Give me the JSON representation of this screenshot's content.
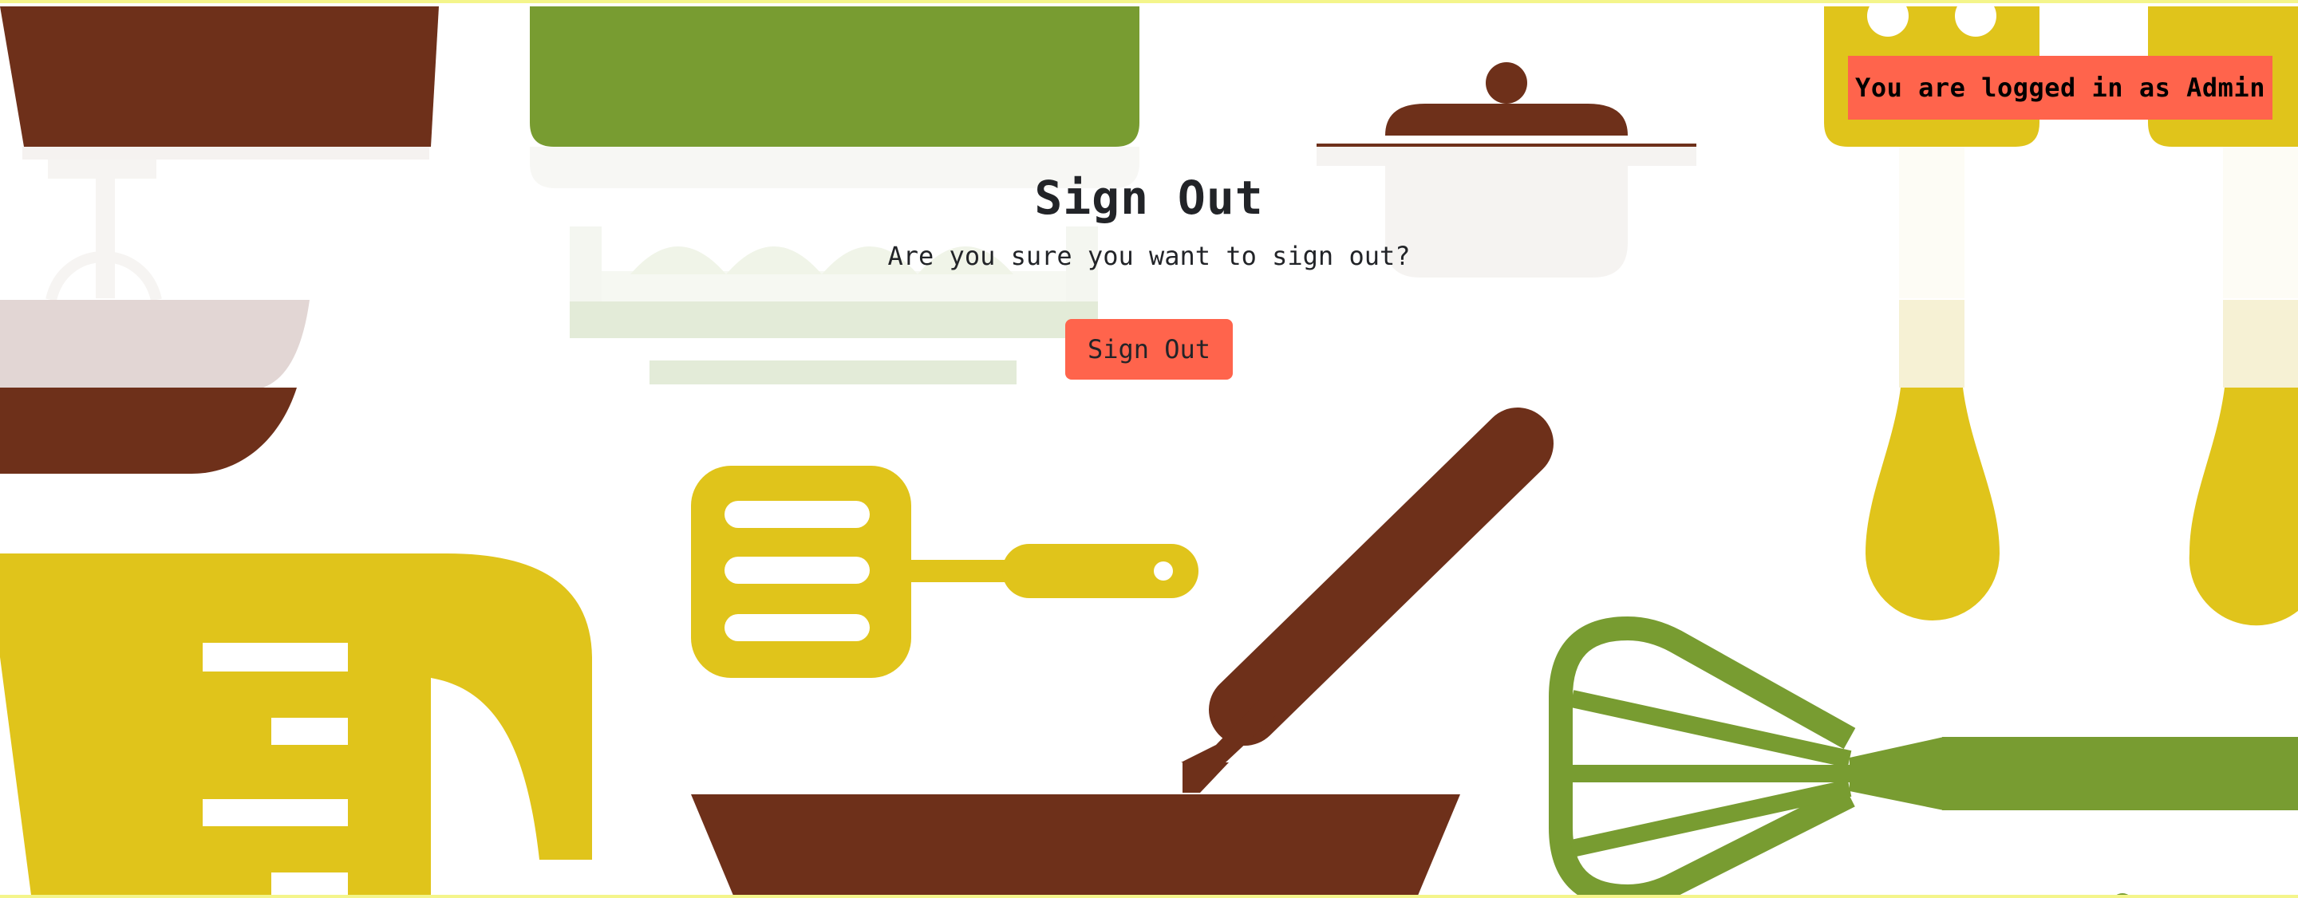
{
  "status": {
    "logged_in_label": "You are logged in as Admin"
  },
  "dialog": {
    "title": "Sign Out",
    "message": "Are you sure you want to sign out?",
    "button_label": "Sign Out"
  },
  "colors": {
    "accent": "#ff644c",
    "brown": "#6e301a",
    "green": "#789c31",
    "yellow": "#e0c41b",
    "text": "#222428"
  },
  "background_icons": [
    "mixer-icon",
    "baking-dish-icon",
    "pot-icon",
    "fork-icon",
    "measuring-cup-icon",
    "spatula-icon",
    "frying-pan-icon",
    "whisk-icon"
  ]
}
